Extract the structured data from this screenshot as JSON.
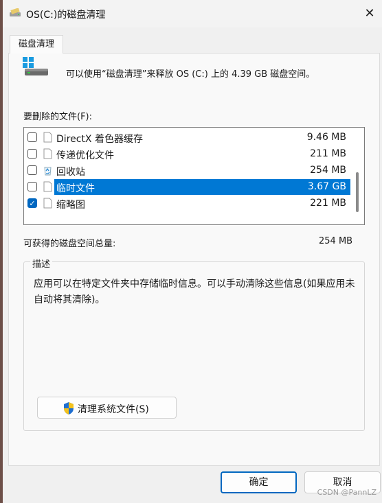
{
  "window": {
    "title": "OS(C:)的磁盘清理",
    "close_glyph": "✕"
  },
  "tabs": [
    {
      "label": "磁盘清理"
    }
  ],
  "info_text": "可以使用“磁盘清理”来释放 OS (C:) 上的 4.39 GB 磁盘空间。",
  "files_label": "要删除的文件(F):",
  "files": [
    {
      "name": "DirectX 着色器缓存",
      "size": "9.46 MB",
      "checked": false,
      "selected": false,
      "icon": "file-icon"
    },
    {
      "name": "传递优化文件",
      "size": "211 MB",
      "checked": false,
      "selected": false,
      "icon": "file-icon"
    },
    {
      "name": "回收站",
      "size": "254 MB",
      "checked": false,
      "selected": false,
      "icon": "recycle-bin-icon"
    },
    {
      "name": "临时文件",
      "size": "3.67 GB",
      "checked": false,
      "selected": true,
      "icon": "file-icon"
    },
    {
      "name": "缩略图",
      "size": "221 MB",
      "checked": true,
      "selected": false,
      "icon": "file-icon"
    }
  ],
  "total_label": "可获得的磁盘空间总量:",
  "total_value": "254 MB",
  "description": {
    "title": "描述",
    "text": "应用可以在特定文件夹中存储临时信息。可以手动清除这些信息(如果应用未自动将其清除)。"
  },
  "system_button": {
    "label": "清理系统文件(S)",
    "icon": "uac-shield-icon"
  },
  "buttons": {
    "ok": "确定",
    "cancel": "取消"
  },
  "watermark": "CSDN @PannLZ",
  "colors": {
    "accent": "#0078d4",
    "checkbox": "#0067c0",
    "background": "#f0f0f0"
  }
}
